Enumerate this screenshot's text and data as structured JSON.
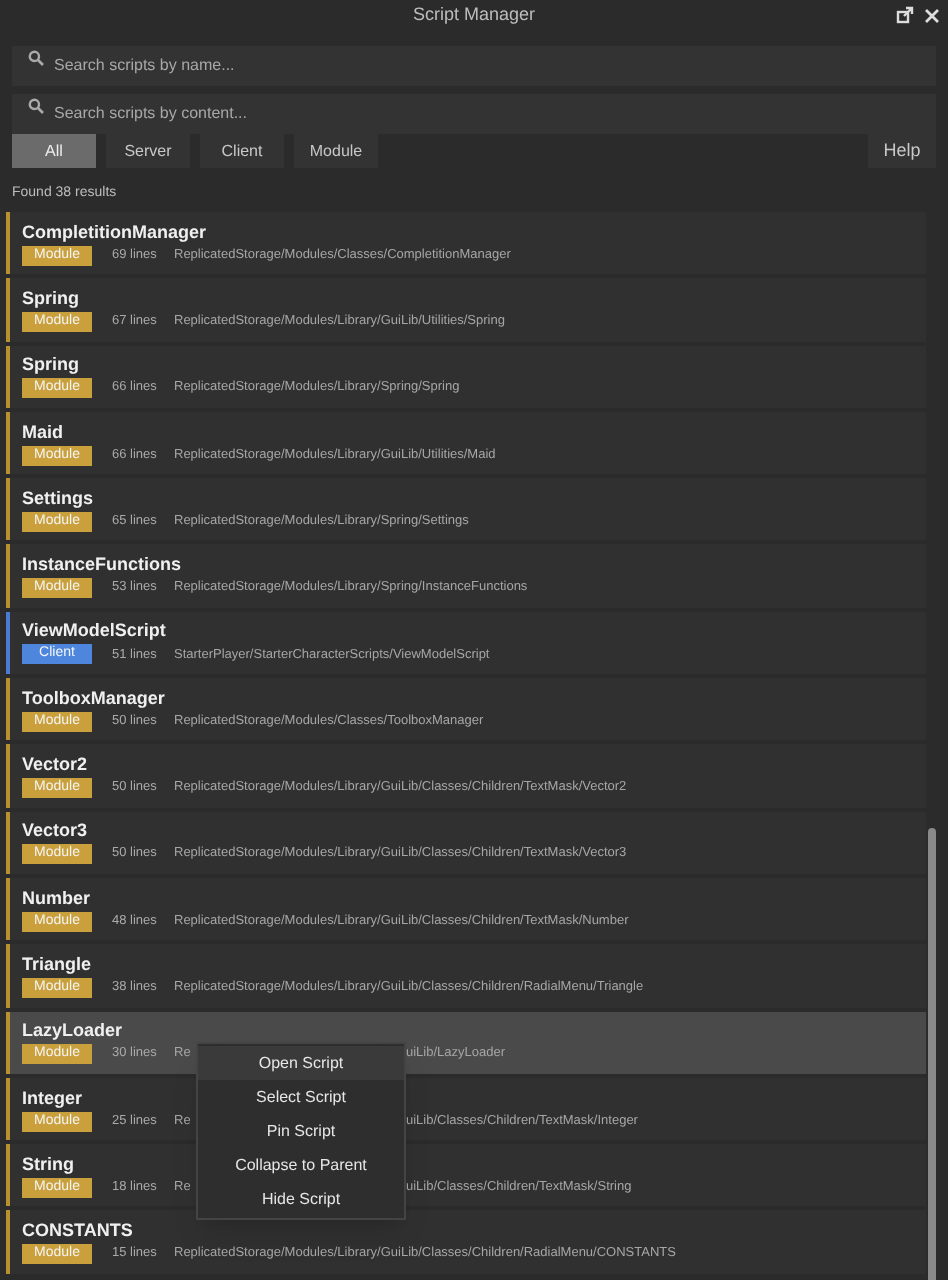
{
  "window": {
    "title": "Script Manager"
  },
  "search_fields": [
    {
      "placeholder": "Search scripts by name..."
    },
    {
      "placeholder": "Search scripts by content..."
    }
  ],
  "filters": [
    {
      "label": "All",
      "selected": true
    },
    {
      "label": "Server",
      "selected": false
    },
    {
      "label": "Client",
      "selected": false
    },
    {
      "label": "Module",
      "selected": false
    }
  ],
  "help_button": "Help",
  "result_count": "Found 38 results",
  "scripts": [
    {
      "name": "CompletitionManager",
      "kind": "module",
      "badge": "Module",
      "lines": "69 lines",
      "path": "ReplicatedStorage/Modules/Classes/CompletitionManager",
      "selected": false
    },
    {
      "name": "Spring",
      "kind": "module",
      "badge": "Module",
      "lines": "67 lines",
      "path": "ReplicatedStorage/Modules/Library/GuiLib/Utilities/Spring",
      "selected": false
    },
    {
      "name": "Spring",
      "kind": "module",
      "badge": "Module",
      "lines": "66 lines",
      "path": "ReplicatedStorage/Modules/Library/Spring/Spring",
      "selected": false
    },
    {
      "name": "Maid",
      "kind": "module",
      "badge": "Module",
      "lines": "66 lines",
      "path": "ReplicatedStorage/Modules/Library/GuiLib/Utilities/Maid",
      "selected": false
    },
    {
      "name": "Settings",
      "kind": "module",
      "badge": "Module",
      "lines": "65 lines",
      "path": "ReplicatedStorage/Modules/Library/Spring/Settings",
      "selected": false
    },
    {
      "name": "InstanceFunctions",
      "kind": "module",
      "badge": "Module",
      "lines": "53 lines",
      "path": "ReplicatedStorage/Modules/Library/Spring/InstanceFunctions",
      "selected": false
    },
    {
      "name": "ViewModelScript",
      "kind": "client",
      "badge": "Client",
      "lines": "51 lines",
      "path": "StarterPlayer/StarterCharacterScripts/ViewModelScript",
      "selected": false
    },
    {
      "name": "ToolboxManager",
      "kind": "module",
      "badge": "Module",
      "lines": "50 lines",
      "path": "ReplicatedStorage/Modules/Classes/ToolboxManager",
      "selected": false
    },
    {
      "name": "Vector2",
      "kind": "module",
      "badge": "Module",
      "lines": "50 lines",
      "path": "ReplicatedStorage/Modules/Library/GuiLib/Classes/Children/TextMask/Vector2",
      "selected": false
    },
    {
      "name": "Vector3",
      "kind": "module",
      "badge": "Module",
      "lines": "50 lines",
      "path": "ReplicatedStorage/Modules/Library/GuiLib/Classes/Children/TextMask/Vector3",
      "selected": false
    },
    {
      "name": "Number",
      "kind": "module",
      "badge": "Module",
      "lines": "48 lines",
      "path": "ReplicatedStorage/Modules/Library/GuiLib/Classes/Children/TextMask/Number",
      "selected": false
    },
    {
      "name": "Triangle",
      "kind": "module",
      "badge": "Module",
      "lines": "38 lines",
      "path": "ReplicatedStorage/Modules/Library/GuiLib/Classes/Children/RadialMenu/Triangle",
      "selected": false
    },
    {
      "name": "LazyLoader",
      "kind": "module",
      "badge": "Module",
      "lines": "30 lines",
      "path": "Re",
      "path_after_menu": "uiLib/LazyLoader",
      "selected": true
    },
    {
      "name": "Integer",
      "kind": "module",
      "badge": "Module",
      "lines": "25 lines",
      "path": "Re",
      "path_after_menu": "uiLib/Classes/Children/TextMask/Integer",
      "selected": false
    },
    {
      "name": "String",
      "kind": "module",
      "badge": "Module",
      "lines": "18 lines",
      "path": "Re",
      "path_after_menu": "uiLib/Classes/Children/TextMask/String",
      "selected": false
    },
    {
      "name": "CONSTANTS",
      "kind": "module",
      "badge": "Module",
      "lines": "15 lines",
      "path": "ReplicatedStorage/Modules/Library/GuiLib/Classes/Children/RadialMenu/CONSTANTS",
      "selected": false
    }
  ],
  "context_menu": [
    {
      "label": "Open Script",
      "selected": true
    },
    {
      "label": "Select Script",
      "selected": false
    },
    {
      "label": "Pin Script",
      "selected": false
    },
    {
      "label": "Collapse to Parent",
      "selected": false
    },
    {
      "label": "Hide Script",
      "selected": false
    }
  ]
}
